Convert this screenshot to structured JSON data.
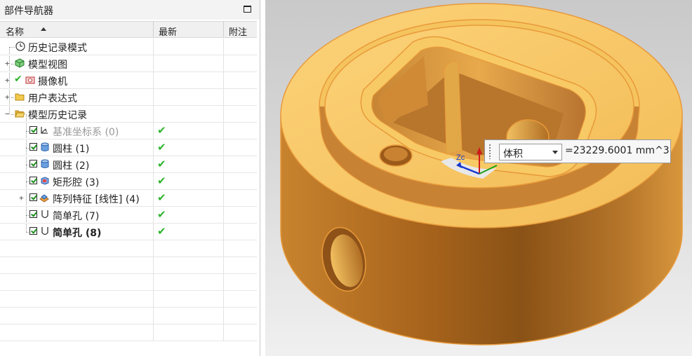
{
  "navigator": {
    "title": "部件导航器",
    "columns": {
      "name": "名称",
      "latest": "最新",
      "note": "附注"
    },
    "rows": [
      {
        "label": "历史记录模式",
        "latest": ""
      },
      {
        "label": "模型视图",
        "latest": ""
      },
      {
        "label": "摄像机",
        "latest": ""
      },
      {
        "label": "用户表达式",
        "latest": ""
      },
      {
        "label": "模型历史记录",
        "latest": ""
      },
      {
        "label": "基准坐标系 (0)",
        "latest": "✔"
      },
      {
        "label": "圆柱 (1)",
        "latest": "✔"
      },
      {
        "label": "圆柱 (2)",
        "latest": "✔"
      },
      {
        "label": "矩形腔 (3)",
        "latest": "✔"
      },
      {
        "label": "阵列特征 [线性] (4)",
        "latest": "✔"
      },
      {
        "label": "简单孔 (7)",
        "latest": "✔"
      },
      {
        "label": "简单孔 (8)",
        "latest": "✔"
      }
    ]
  },
  "viewport": {
    "measure": {
      "type": "体积",
      "value": "=23229.6001 mm^3"
    },
    "axis_label": "Zc",
    "part_color": "#e8a040"
  }
}
